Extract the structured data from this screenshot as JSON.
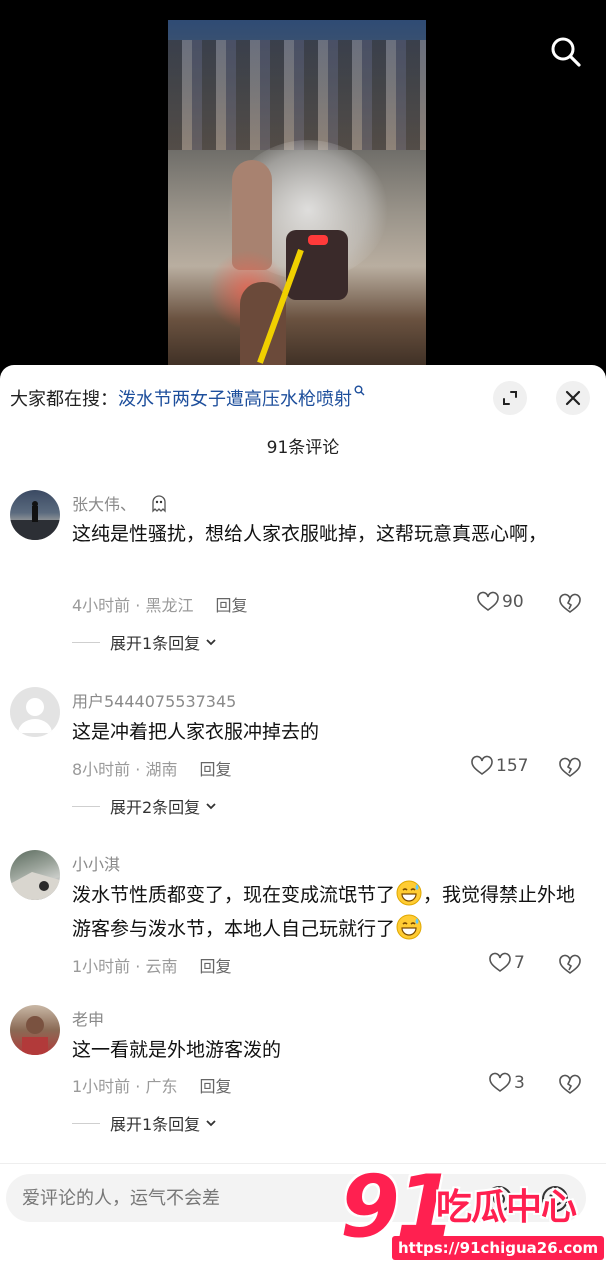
{
  "search": {
    "prefix": "大家都在搜：",
    "term": "泼水节两女子遭高压水枪喷射"
  },
  "comments_header": {
    "count_label": "91条评论"
  },
  "comments": [
    {
      "username": "张大伟、",
      "text": "这纯是性骚扰，想给人家衣服呲掉，这帮玩意真恶心啊，",
      "time_location": "4小时前 · 黑龙江",
      "reply_label": "回复",
      "likes": "90",
      "expand_label": "展开1条回复"
    },
    {
      "username": "用户5444075537345",
      "text": "这是冲着把人家衣服冲掉去的",
      "time_location": "8小时前 · 湖南",
      "reply_label": "回复",
      "likes": "157",
      "expand_label": "展开2条回复"
    },
    {
      "username": "小小淇",
      "text_part1": "泼水节性质都变了，现在变成流氓节了",
      "text_part2": "，我觉得禁止外地游客参与泼水节，本地人自己玩就行了",
      "time_location": "1小时前 · 云南",
      "reply_label": "回复",
      "likes": "7"
    },
    {
      "username": "老申",
      "text": "这一看就是外地游客泼的",
      "time_location": "1小时前 · 广东",
      "reply_label": "回复",
      "likes": "3",
      "expand_label": "展开1条回复"
    }
  ],
  "input": {
    "placeholder": "爱评论的人，运气不会差"
  },
  "watermark": {
    "number": "91",
    "name": "吃瓜中心",
    "url": "https://91chigua26.com"
  },
  "colors": {
    "search_term": "#1e4f9c",
    "watermark": "#ff2050",
    "meta_text": "#9a9a9a"
  },
  "icons": [
    "search-icon",
    "expand-icon",
    "close-icon",
    "ghost-icon",
    "heart-icon",
    "broken-heart-icon",
    "chevron-down-icon",
    "grin-sweat-emoji",
    "at-icon",
    "smile-icon"
  ]
}
